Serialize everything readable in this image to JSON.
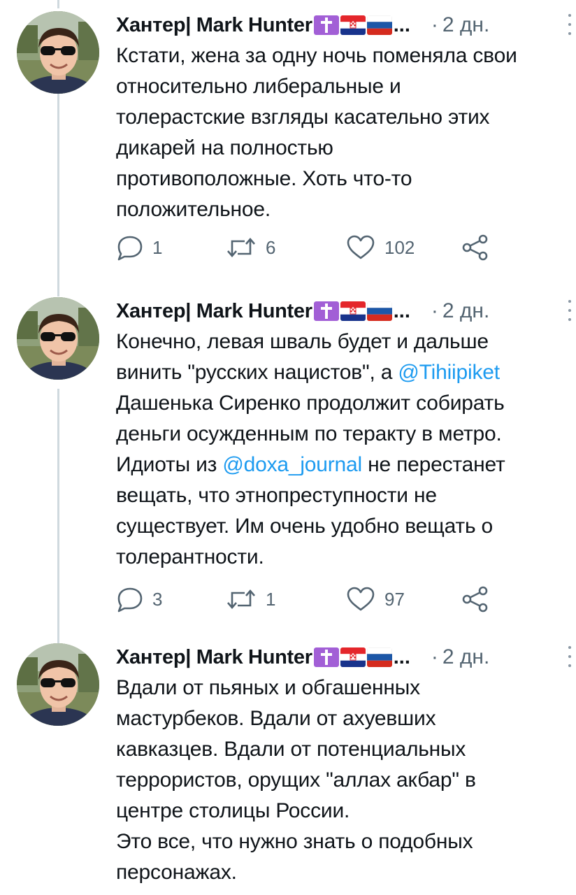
{
  "tweets": [
    {
      "author": "Хантер| Mark Hunter",
      "ellipsis": "...",
      "dot": "·",
      "time": "2 дн.",
      "lines": [
        [
          {
            "t": "Кстати, жена за одну ночь поменяла свои"
          }
        ],
        [
          {
            "t": "относительно либеральные и"
          }
        ],
        [
          {
            "t": "толерастские взгляды касательно этих"
          }
        ],
        [
          {
            "t": "дикарей на полностью"
          }
        ],
        [
          {
            "t": "противоположные. Хоть что-то"
          }
        ],
        [
          {
            "t": "положительное."
          }
        ]
      ],
      "replies": "1",
      "retweets": "6",
      "likes": "102"
    },
    {
      "author": "Хантер| Mark Hunter",
      "ellipsis": "...",
      "dot": "·",
      "time": "2 дн.",
      "lines": [
        [
          {
            "t": "Конечно, левая шваль будет и дальше"
          }
        ],
        [
          {
            "t": "винить \"русских нацистов\", а "
          },
          {
            "t": "@Tihiipiket",
            "m": true
          }
        ],
        [
          {
            "t": "Дашенька Сиренко продолжит собирать"
          }
        ],
        [
          {
            "t": "деньги осужденным по теракту в метро."
          }
        ],
        [
          {
            "t": "Идиоты из "
          },
          {
            "t": "@doxa_journal",
            "m": true
          },
          {
            "t": " не перестанет"
          }
        ],
        [
          {
            "t": "вещать, что этнопреступности не"
          }
        ],
        [
          {
            "t": "существует. Им очень удобно вещать о"
          }
        ],
        [
          {
            "t": "толерантности."
          }
        ]
      ],
      "replies": "3",
      "retweets": "1",
      "likes": "97"
    },
    {
      "author": "Хантер| Mark Hunter",
      "ellipsis": "...",
      "dot": "·",
      "time": "2 дн.",
      "lines": [
        [
          {
            "t": "Вдали от пьяных и обгашенных"
          }
        ],
        [
          {
            "t": "мастурбеков. Вдали от ахуевших"
          }
        ],
        [
          {
            "t": "кавказцев. Вдали от потенциальных"
          }
        ],
        [
          {
            "t": "террористов, орущих \"аллах акбар\" в"
          }
        ],
        [
          {
            "t": "центре столицы России."
          }
        ],
        [
          {
            "t": "Это все, что нужно знать о подобных"
          }
        ],
        [
          {
            "t": "персонажах."
          }
        ]
      ]
    }
  ],
  "icons": {
    "emoji": [
      "latin-cross-emoji",
      "croatia-flag-emoji",
      "russia-flag-emoji"
    ],
    "actions": [
      "reply-icon",
      "retweet-icon",
      "like-icon",
      "share-icon"
    ],
    "menu": "more-options-icon"
  },
  "colors": {
    "text": "#0f1419",
    "secondary": "#536471",
    "mention": "#1d9bf0",
    "thread_line": "#cfd9de",
    "cross_emoji": "#a25fd6"
  }
}
